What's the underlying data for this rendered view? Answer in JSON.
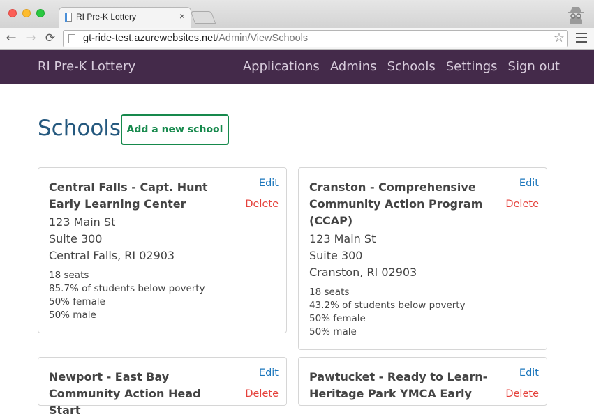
{
  "browser": {
    "tab_title": "RI Pre-K Lottery",
    "tab_close": "×",
    "url_host": "gt-ride-test.azurewebsites.net",
    "url_path": "/Admin/ViewSchools",
    "back": "←",
    "forward": "→",
    "reload": "⟳",
    "bookmark_star": "☆",
    "icons": {
      "close": "close-icon",
      "incognito": "incognito-icon",
      "star": "star-icon",
      "menu": "hamburger-menu-icon"
    }
  },
  "navbar": {
    "brand": "RI Pre-K Lottery",
    "links": [
      "Applications",
      "Admins",
      "Schools",
      "Settings",
      "Sign out"
    ],
    "background": "#442a4a"
  },
  "page": {
    "title": "Schools",
    "add_button": "Add a new school"
  },
  "colors": {
    "title": "#24587e",
    "add_button": "#16894c",
    "edit": "#1b76bc",
    "delete": "#e5413b"
  },
  "schools": [
    {
      "name": "Central Falls - Capt. Hunt Early Learning Center",
      "edit": "Edit",
      "delete": "Delete",
      "address": [
        "123 Main St",
        "Suite 300",
        "Central Falls, RI 02903"
      ],
      "stats": [
        "18 seats",
        "85.7% of students below poverty",
        "50% female",
        "50% male"
      ]
    },
    {
      "name": "Cranston - Comprehensive Community Action Program (CCAP)",
      "edit": "Edit",
      "delete": "Delete",
      "address": [
        "123 Main St",
        "Suite 300",
        "Cranston, RI 02903"
      ],
      "stats": [
        "18 seats",
        "43.2% of students below poverty",
        "50% female",
        "50% male"
      ]
    },
    {
      "name": "Newport - East Bay Community Action Head Start",
      "edit": "Edit",
      "delete": "Delete"
    },
    {
      "name": "Pawtucket - Ready to Learn-Heritage Park YMCA Early",
      "edit": "Edit",
      "delete": "Delete"
    }
  ]
}
